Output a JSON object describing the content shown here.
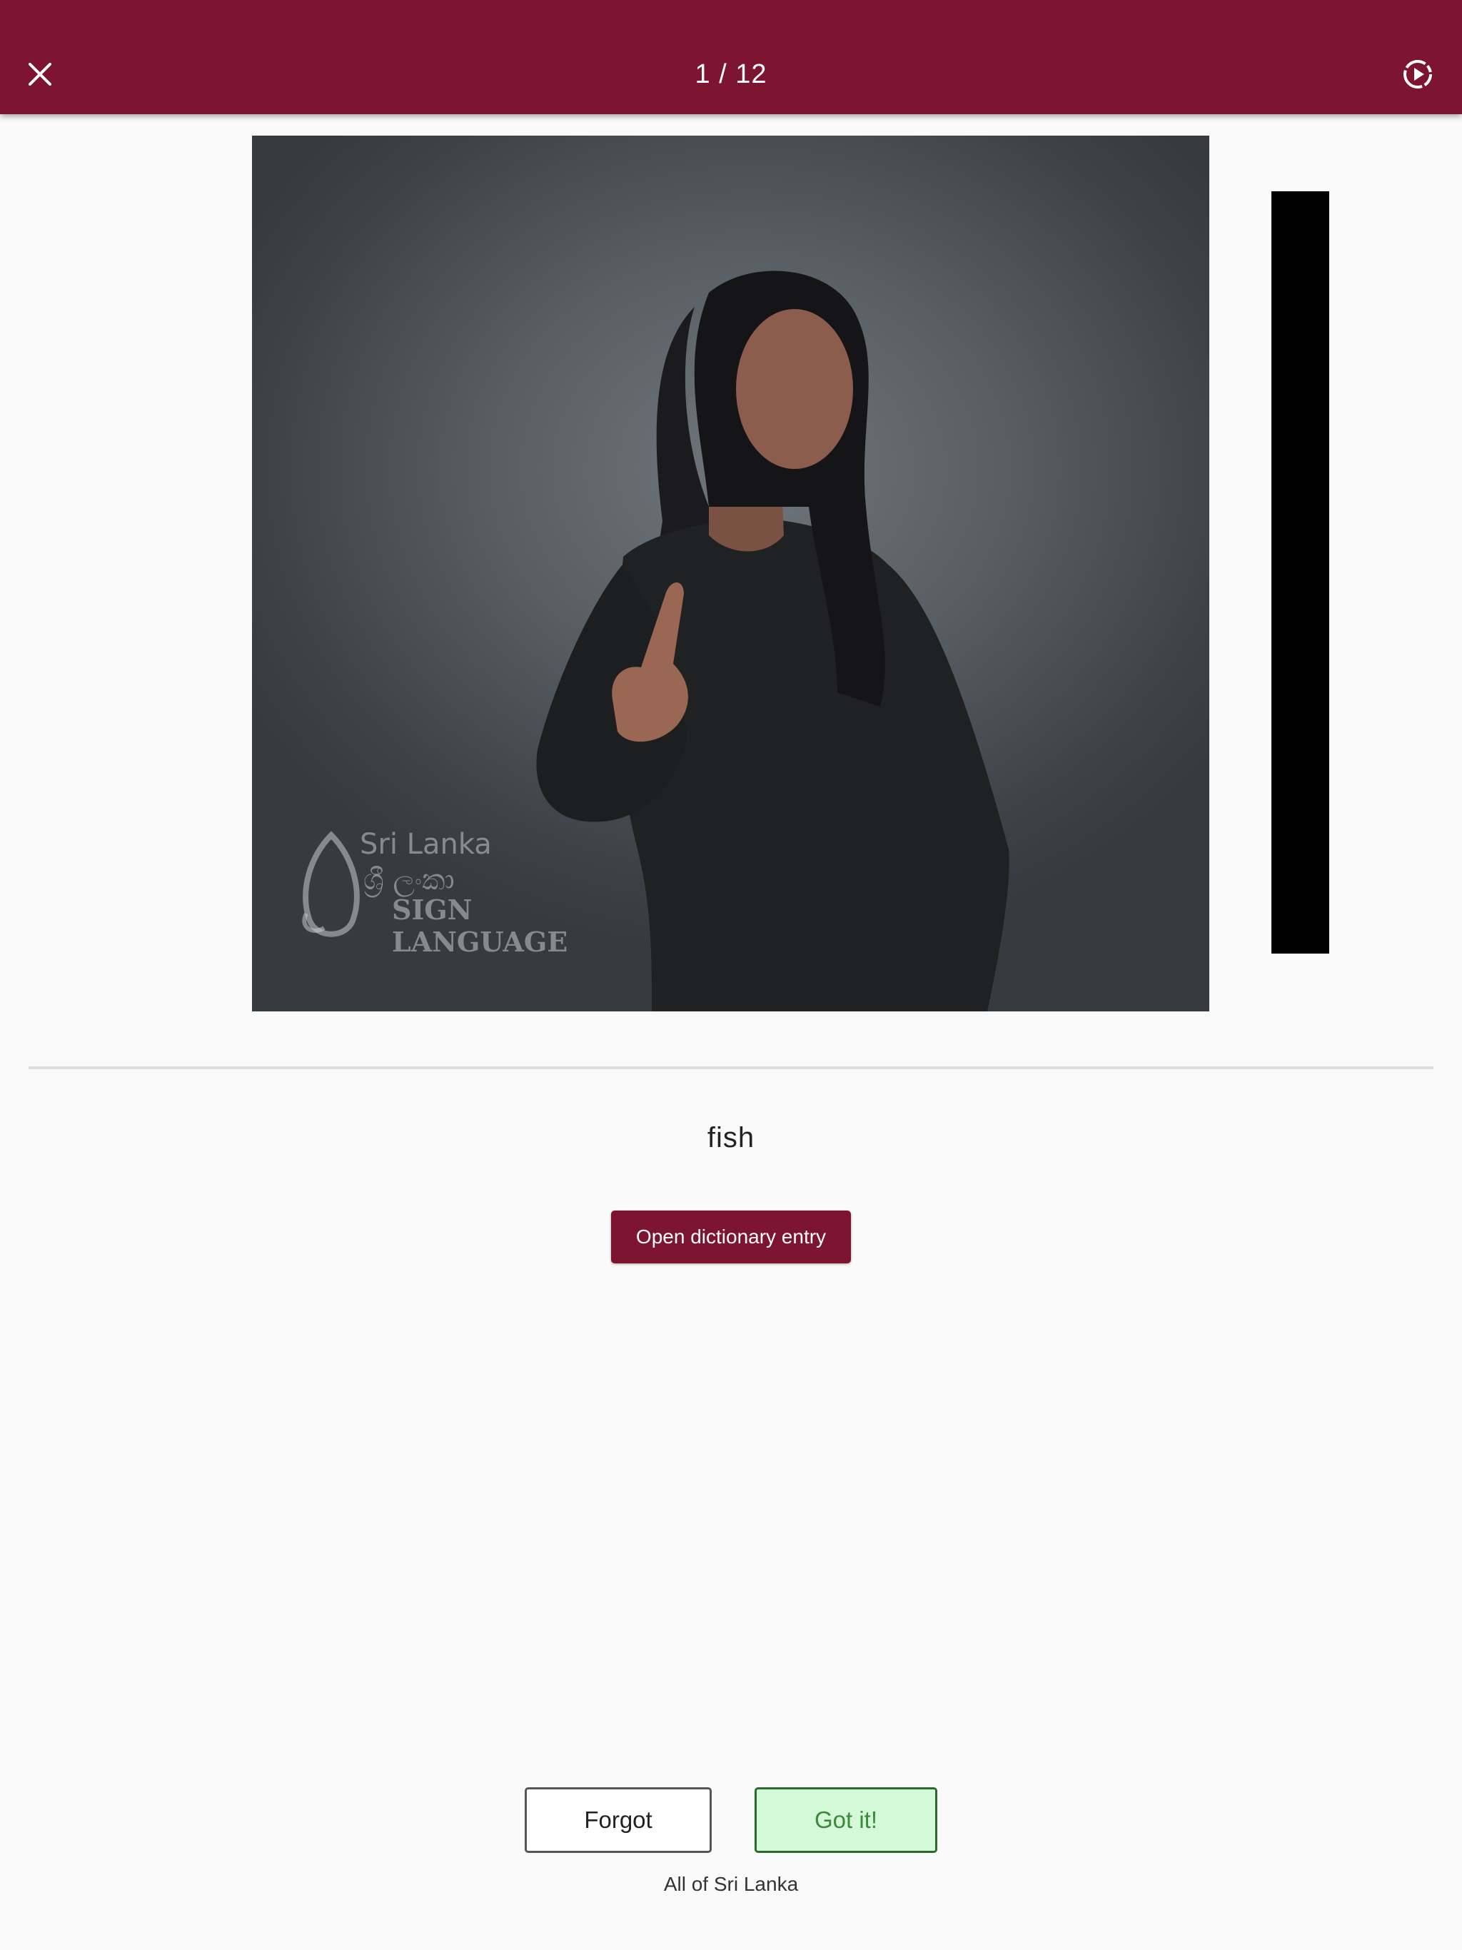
{
  "header": {
    "progress": "1 / 12",
    "close_icon": "close-icon",
    "autoplay_icon": "play-circle-dashed-icon",
    "background_color": "#7d1530"
  },
  "video": {
    "watermark": {
      "line1": "Sri Lanka",
      "line2": "ශ්‍රී ලංකා",
      "line3": "SIGN LANGUAGE"
    }
  },
  "card": {
    "word": "fish",
    "dictionary_button_label": "Open dictionary entry"
  },
  "actions": {
    "forgot_label": "Forgot",
    "got_it_label": "Got it!",
    "got_it_color": "#3a8a3a"
  },
  "footer": {
    "deck_name": "All of Sri Lanka"
  }
}
